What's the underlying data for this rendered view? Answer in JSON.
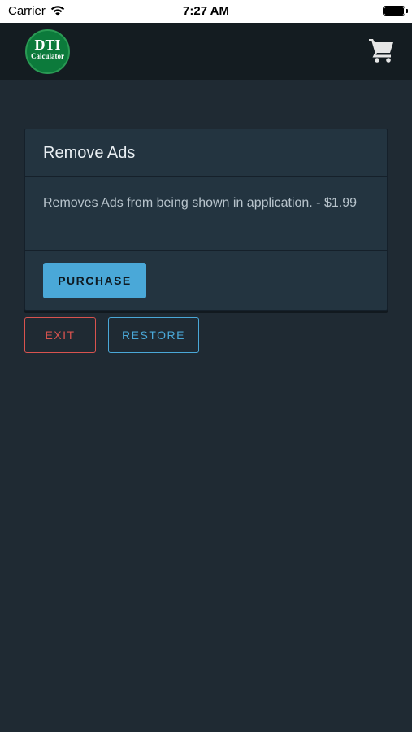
{
  "status_bar": {
    "carrier": "Carrier",
    "time": "7:27 AM"
  },
  "header": {
    "logo_line1": "DTI",
    "logo_line2": "Calculator",
    "cart_icon": "shopping-cart-icon"
  },
  "card": {
    "title": "Remove Ads",
    "description": "Removes Ads from being shown in application. - $1.99",
    "purchase_label": "PURCHASE"
  },
  "actions": {
    "exit_label": "EXIT",
    "restore_label": "RESTORE"
  },
  "colors": {
    "background": "#1f2a33",
    "header": "#141c21",
    "card": "#233440",
    "primary": "#4aa8d8",
    "danger": "#d9534f",
    "logo_green": "#0c7a3b"
  }
}
